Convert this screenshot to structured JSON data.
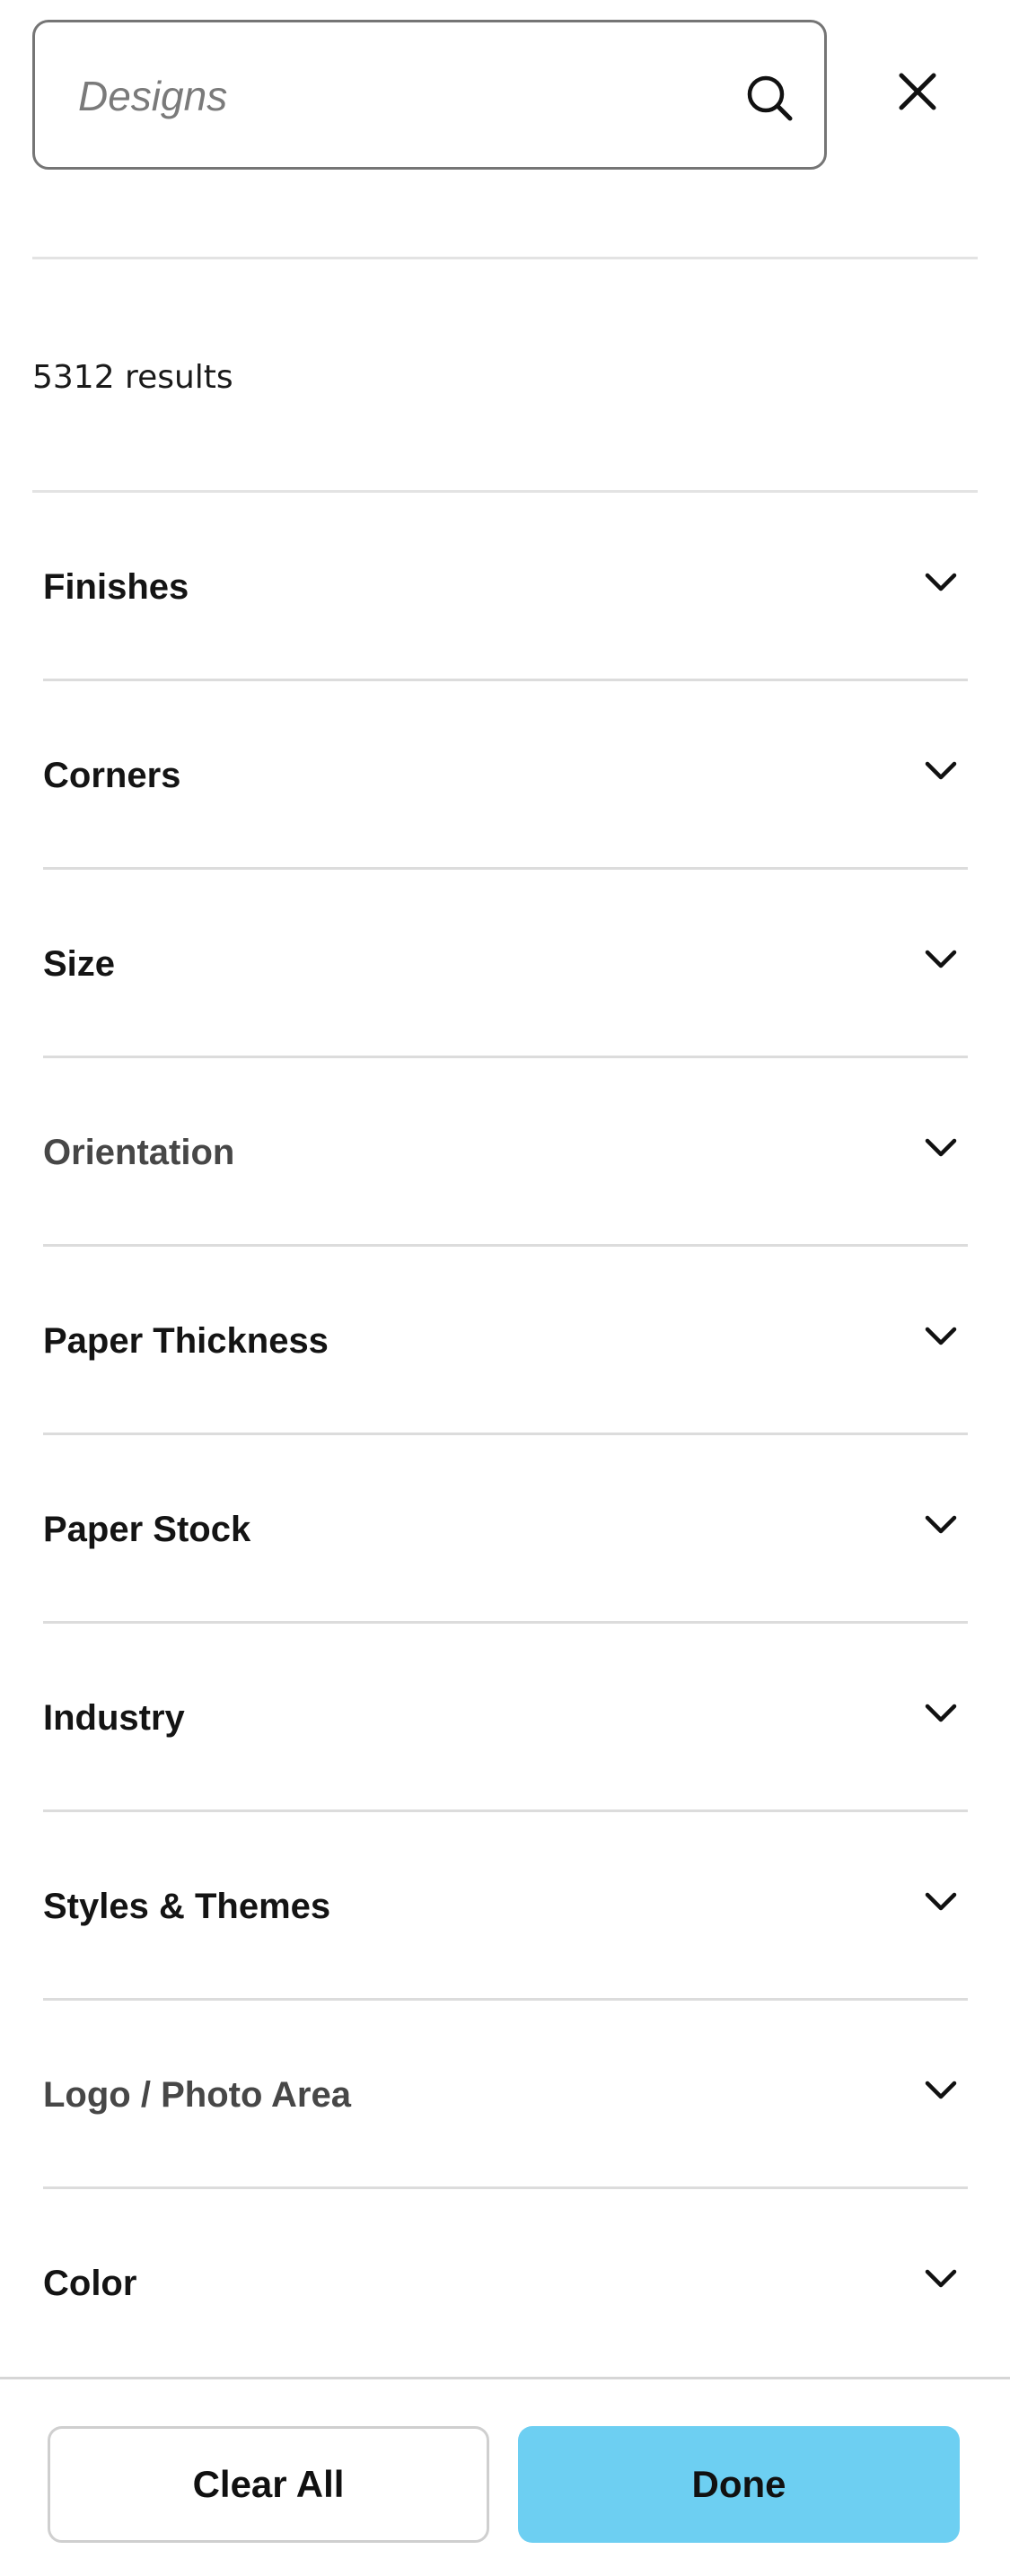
{
  "search": {
    "placeholder": "Designs",
    "value": ""
  },
  "icons": {
    "search": "search-icon",
    "close": "close-icon",
    "chevron": "chevron-down-icon"
  },
  "results": {
    "count_text": "5312 results"
  },
  "filters": [
    {
      "label": "Finishes",
      "muted": false
    },
    {
      "label": "Corners",
      "muted": false
    },
    {
      "label": "Size",
      "muted": false
    },
    {
      "label": "Orientation",
      "muted": true
    },
    {
      "label": "Paper Thickness",
      "muted": false
    },
    {
      "label": "Paper Stock",
      "muted": false
    },
    {
      "label": "Industry",
      "muted": false
    },
    {
      "label": "Styles & Themes",
      "muted": false
    },
    {
      "label": "Logo / Photo Area",
      "muted": true
    },
    {
      "label": "Color",
      "muted": false
    }
  ],
  "actions": {
    "clear_label": "Clear All",
    "done_label": "Done"
  },
  "colors": {
    "accent": "#6dcff2",
    "border": "#757575",
    "divider": "#dcdcdc",
    "muted_text": "#474747"
  }
}
